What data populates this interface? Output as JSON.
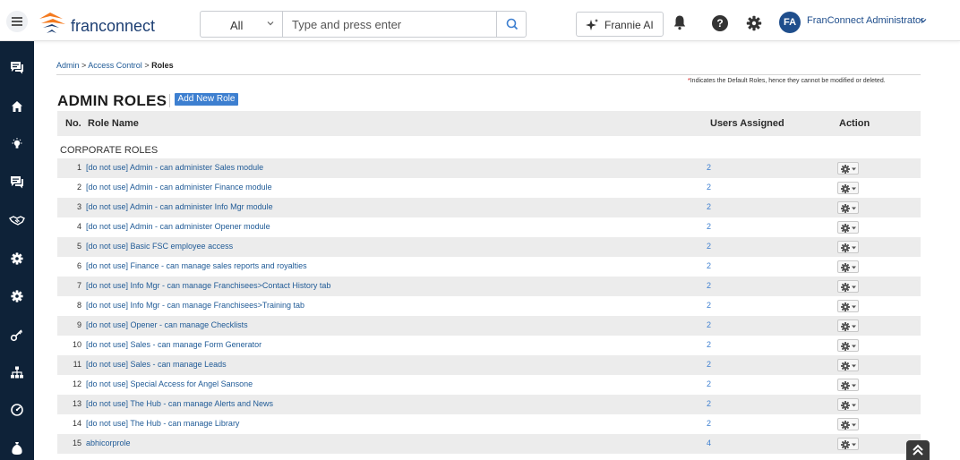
{
  "header": {
    "brand": "franconnect",
    "search": {
      "scope": "All",
      "placeholder": "Type and press enter"
    },
    "frannie_label": "Frannie AI",
    "help_glyph": "?",
    "user": {
      "initials": "FA",
      "name": "FranConnect Administrator"
    }
  },
  "sidebar_icons": [
    "messages-icon",
    "home-icon",
    "lightbulb-icon",
    "chat-icon",
    "handshake-icon",
    "settings-icon",
    "cog-icon",
    "key-icon",
    "org-chart-icon",
    "dashboard-icon",
    "money-bag-icon"
  ],
  "breadcrumb": {
    "items": [
      "Admin",
      "Access Control"
    ],
    "separator": " > ",
    "current": "Roles"
  },
  "default_note": {
    "star": "*",
    "text": "Indicates the Default Roles, hence they cannot be modified or deleted."
  },
  "page": {
    "title": "ADMIN ROLES",
    "add_button": "Add New Role"
  },
  "table": {
    "columns": {
      "no": "No.",
      "role_name": "Role Name",
      "users": "Users Assigned",
      "action": "Action"
    },
    "group_label": "CORPORATE ROLES",
    "rows": [
      {
        "no": "1",
        "name": "[do not use] Admin - can administer Sales module",
        "users": "2"
      },
      {
        "no": "2",
        "name": "[do not use] Admin - can administer Finance module",
        "users": "2"
      },
      {
        "no": "3",
        "name": "[do not use] Admin - can administer Info Mgr module",
        "users": "2"
      },
      {
        "no": "4",
        "name": "[do not use] Admin - can administer Opener module",
        "users": "2"
      },
      {
        "no": "5",
        "name": "[do not use] Basic FSC employee access",
        "users": "2"
      },
      {
        "no": "6",
        "name": "[do not use] Finance - can manage sales reports and royalties",
        "users": "2"
      },
      {
        "no": "7",
        "name": "[do not use] Info Mgr - can manage Franchisees>Contact History tab",
        "users": "2"
      },
      {
        "no": "8",
        "name": "[do not use] Info Mgr - can manage Franchisees>Training tab",
        "users": "2"
      },
      {
        "no": "9",
        "name": "[do not use] Opener - can manage Checklists",
        "users": "2"
      },
      {
        "no": "10",
        "name": "[do not use] Sales - can manage Form Generator",
        "users": "2"
      },
      {
        "no": "11",
        "name": "[do not use] Sales - can manage Leads",
        "users": "2"
      },
      {
        "no": "12",
        "name": "[do not use] Special Access for Angel Sansone",
        "users": "2"
      },
      {
        "no": "13",
        "name": "[do not use] The Hub - can manage Alerts and News",
        "users": "2"
      },
      {
        "no": "14",
        "name": "[do not use] The Hub - can manage Library",
        "users": "2"
      },
      {
        "no": "15",
        "name": "abhicorprole",
        "users": "4"
      }
    ]
  },
  "colors": {
    "sidebar": "#0e2238",
    "link": "#1f5a96",
    "accent": "#3d7fd0",
    "logo_orange": "#f47b20"
  }
}
